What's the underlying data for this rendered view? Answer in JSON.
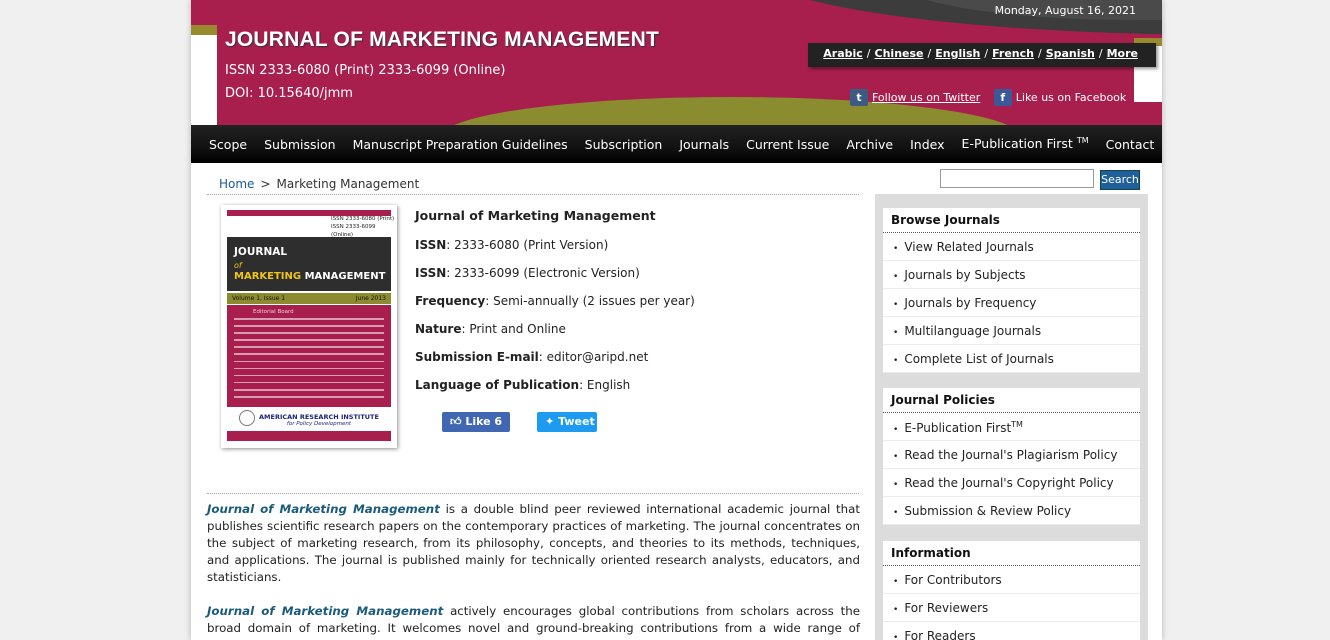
{
  "header": {
    "date": "Monday, August 16, 2021",
    "title": "JOURNAL OF MARKETING MANAGEMENT",
    "issn": "ISSN 2333-6080 (Print) 2333-6099 (Online)",
    "doi": "DOI: 10.15640/jmm",
    "languages": [
      "Arabic",
      "Chinese",
      "English",
      "French",
      "Spanish",
      "More"
    ],
    "social": {
      "twitter_icon": "t",
      "twitter_label": "Follow us on Twitter",
      "facebook_icon": "f",
      "facebook_label": "Like us on Facebook"
    }
  },
  "nav": {
    "items": [
      "Scope",
      "Submission",
      "Manuscript Preparation Guidelines",
      "Subscription",
      "Journals",
      "Current Issue",
      "Archive",
      "Index",
      "E-Publication First",
      "Contact"
    ],
    "tm": "TM"
  },
  "breadcrumb": {
    "home": "Home",
    "separator": ">",
    "current": "Marketing Management"
  },
  "search": {
    "value": "",
    "button": "Search"
  },
  "cover": {
    "issn_print": "ISSN 2333-6080 (Print)",
    "issn_online": "ISSN 2333-6099 (Online)",
    "title_line1": "JOURNAL",
    "title_line2": "of",
    "title_line3a": "MARKETING",
    "title_line3b": " MANAGEMENT",
    "volume": "Volume 1, Issue 1",
    "date": "June 2013",
    "editorial": "Editorial Board",
    "publisher_line1": "AMERICAN RESEARCH INSTITUTE",
    "publisher_line2": "for Policy Development"
  },
  "info": {
    "title": "Journal of Marketing Management",
    "issn_print_label": "ISSN",
    "issn_print_value": ": 2333-6080 (Print Version)",
    "issn_online_label": "ISSN",
    "issn_online_value": ": 2333-6099 (Electronic Version)",
    "frequency_label": "Frequency",
    "frequency_value": ": Semi-annually (2 issues per year)",
    "nature_label": "Nature",
    "nature_value": ": Print and Online",
    "email_label": "Submission E-mail",
    "email_value": ": editor@aripd.net",
    "language_label": "Language of Publication",
    "language_value": ": English",
    "like": "Like 6",
    "tweet": "Tweet"
  },
  "description": {
    "journal_name": "Journal of Marketing Management",
    "p1_rest": " is a double blind peer reviewed international academic journal that publishes scientific research papers on the contemporary practices of marketing. The journal concentrates on the subject of marketing research, from its philosophy, concepts, and theories to its methods, techniques, and applications. The journal is published mainly for technically oriented research analysts, educators, and statisticians.",
    "p2_rest": " actively encourages global contributions from scholars across the broad domain of marketing. It welcomes novel and ground-breaking contributions from a wide range of research"
  },
  "sidebar": {
    "browse": {
      "title": "Browse Journals",
      "items": [
        "View Related Journals",
        "Journals by Subjects",
        "Journals by Frequency",
        "Multilanguage Journals",
        "Complete List of Journals"
      ]
    },
    "policies": {
      "title": "Journal Policies",
      "items": [
        "E-Publication First",
        "Read the Journal's Plagiarism Policy",
        "Read the Journal's Copyright Policy",
        "Submission & Review Policy"
      ],
      "tm": "TM"
    },
    "information": {
      "title": "Information",
      "items": [
        "For Contributors",
        "For Reviewers",
        "For Readers"
      ]
    }
  },
  "colors": {
    "brand": "#a81e4d",
    "olive": "#8a8c2f",
    "nav": "#111111",
    "link": "#1a5a96"
  }
}
